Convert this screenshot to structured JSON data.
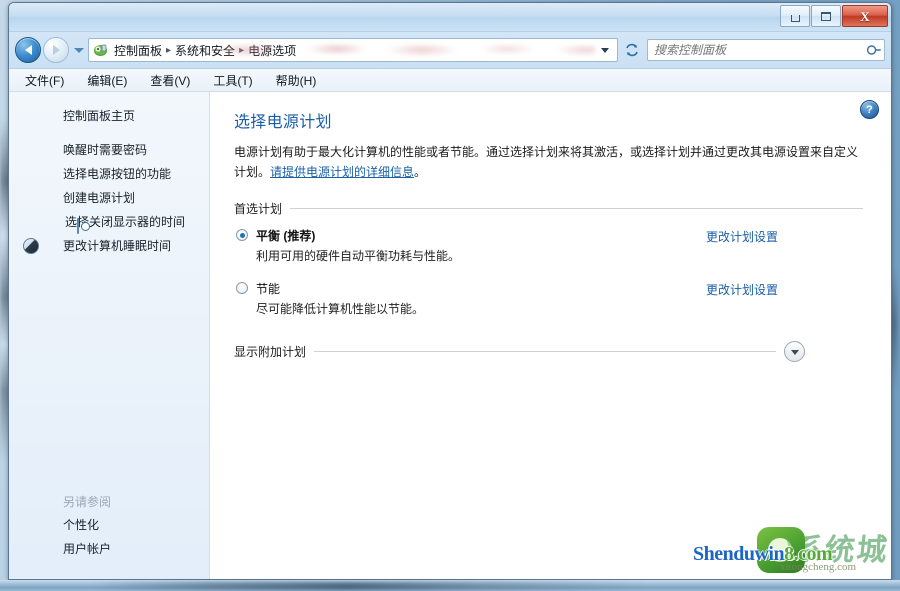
{
  "window": {
    "caption": {
      "minimize_label": "",
      "maximize_label": "",
      "close_label": "X"
    }
  },
  "toolbar": {
    "back_tooltip": "后退",
    "forward_tooltip": "前进",
    "breadcrumbs": [
      "控制面板",
      "系统和安全",
      "电源选项"
    ],
    "separator": "▸",
    "refresh_label": "↻"
  },
  "search": {
    "placeholder": "搜索控制面板",
    "value": "",
    "icon": "search-icon"
  },
  "menu": {
    "items": [
      {
        "label": "文件(F)"
      },
      {
        "label": "编辑(E)"
      },
      {
        "label": "查看(V)"
      },
      {
        "label": "工具(T)"
      },
      {
        "label": "帮助(H)"
      }
    ]
  },
  "sidebar": {
    "home_label": "控制面板主页",
    "items": [
      {
        "label": "唤醒时需要密码",
        "icon": ""
      },
      {
        "label": "选择电源按钮的功能",
        "icon": ""
      },
      {
        "label": "创建电源计划",
        "icon": ""
      },
      {
        "label": "选择关闭显示器的时间",
        "icon": "monitor-clock-icon"
      },
      {
        "label": "更改计算机睡眠时间",
        "icon": "moon-icon"
      }
    ],
    "see_also": {
      "title": "另请参阅",
      "links": [
        {
          "label": "个性化"
        },
        {
          "label": "用户帐户"
        }
      ]
    }
  },
  "content": {
    "help_icon_label": "?",
    "title": "选择电源计划",
    "description_part1": "电源计划有助于最大化计算机的性能或者节能。通过选择计划来将其激活，或选择计划并通过更改其电源设置来自定义计划。",
    "description_link": "请提供电源计划的详细信息",
    "description_part2": "。",
    "group_label": "首选计划",
    "plans": [
      {
        "name": "平衡 (推荐)",
        "description": "利用可用的硬件自动平衡功耗与性能。",
        "selected": true,
        "change_link": "更改计划设置"
      },
      {
        "name": "节能",
        "description": "尽可能降低计算机性能以节能。",
        "selected": false,
        "change_link": "更改计划设置"
      }
    ],
    "expander": {
      "label": "显示附加计划",
      "icon": "chevron-down-icon"
    }
  },
  "watermark": {
    "primary_blue": "Shenduwin",
    "primary_green": "8.com",
    "secondary": "xitongcheng.com",
    "cjk_overlay": "系统城"
  },
  "colors": {
    "accent_link": "#1a5fa8",
    "title_heading": "#1b5ea8",
    "radio_selected": "#2272b8",
    "close_button": "#bf3a24",
    "titlebar": "#c6def2"
  }
}
